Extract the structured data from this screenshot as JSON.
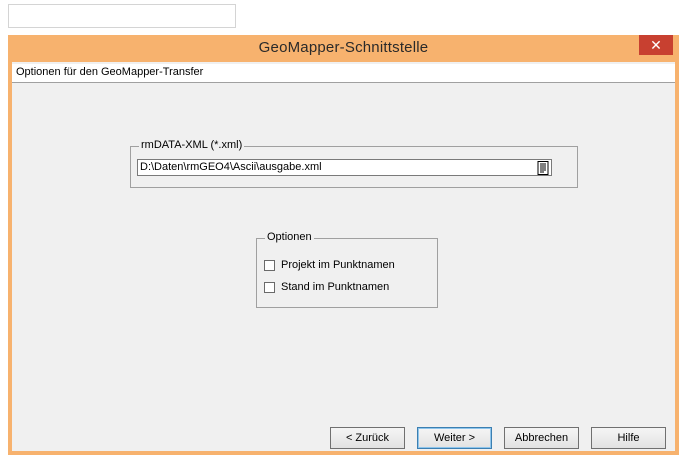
{
  "window": {
    "title": "GeoMapper-Schnittstelle",
    "close_symbol": "✕"
  },
  "banner": {
    "text": "Optionen für den GeoMapper-Transfer"
  },
  "file_group": {
    "label": "rmDATA-XML (*.xml)",
    "path_value": "D:\\Daten\\rmGEO4\\Ascii\\ausgabe.xml",
    "browse_icon": "document-icon"
  },
  "options_group": {
    "label": "Optionen",
    "items": [
      {
        "label": "Projekt im Punktnamen",
        "checked": false
      },
      {
        "label": "Stand im Punktnamen",
        "checked": false
      }
    ]
  },
  "buttons": {
    "back": "< Zurück",
    "next": "Weiter >",
    "cancel": "Abbrechen",
    "help": "Hilfe"
  },
  "colors": {
    "titlebar": "#f7b26e",
    "close_button": "#c84030",
    "client_background": "#f0f0f0"
  }
}
